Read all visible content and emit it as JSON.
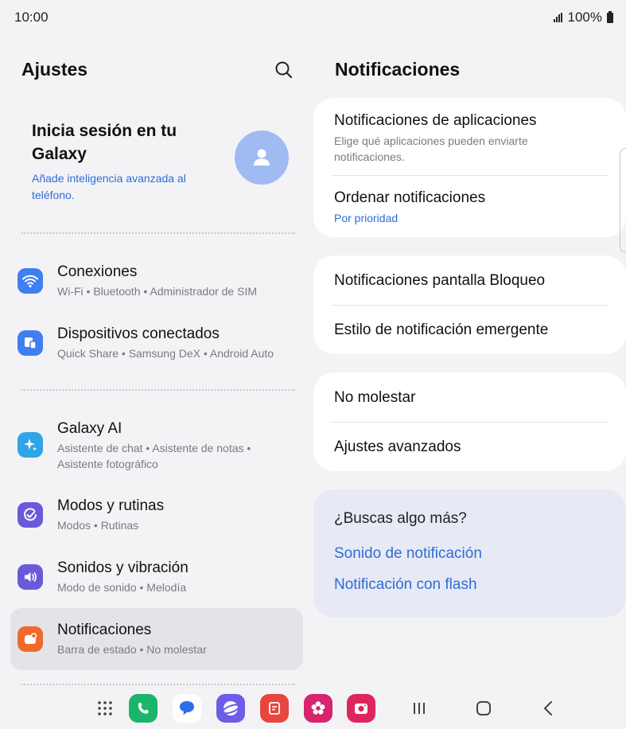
{
  "status_bar": {
    "time": "10:00",
    "battery_percent": "100%"
  },
  "settings": {
    "title": "Ajustes",
    "search_icon": "search-icon",
    "account": {
      "title": "Inicia sesión en tu Galaxy",
      "subtitle": "Añade inteligencia avanzada al teléfono.",
      "avatar_icon": "person-icon"
    },
    "items": [
      {
        "label": "Conexiones",
        "subtitle": "Wi-Fi  •  Bluetooth  •  Administrador de SIM",
        "icon": "wifi-icon",
        "color": "#3f7ff0"
      },
      {
        "label": "Dispositivos conectados",
        "subtitle": "Quick Share  •  Samsung DeX  •  Android Auto",
        "icon": "devices-icon",
        "color": "#3f7ff0"
      },
      {
        "label": "Galaxy AI",
        "subtitle": "Asistente de chat  •  Asistente de notas  •  Asistente fotográfico",
        "icon": "sparkle-icon",
        "color": "#2fa4e8"
      },
      {
        "label": "Modos y rutinas",
        "subtitle": "Modos  •  Rutinas",
        "icon": "check-circle-icon",
        "color": "#6a5ad8"
      },
      {
        "label": "Sonidos y vibración",
        "subtitle": "Modo de sonido  •  Melodía",
        "icon": "speaker-icon",
        "color": "#6a5ad8"
      },
      {
        "label": "Notificaciones",
        "subtitle": "Barra de estado  •  No molestar",
        "icon": "notification-icon",
        "color": "#ee6a2c",
        "selected": true
      }
    ]
  },
  "notifications": {
    "title": "Notificaciones",
    "groups": [
      {
        "rows": [
          {
            "label": "Notificaciones de aplicaciones",
            "subtitle": "Elige qué aplicaciones pueden enviarte notificaciones."
          },
          {
            "label": "Ordenar notificaciones",
            "subtitle": "Por prioridad"
          }
        ]
      },
      {
        "rows": [
          {
            "label": "Notificaciones pantalla Bloqueo"
          },
          {
            "label": "Estilo de notificación emergente"
          }
        ]
      },
      {
        "rows": [
          {
            "label": "No molestar"
          },
          {
            "label": "Ajustes avanzados"
          }
        ]
      }
    ],
    "looking_for_more": {
      "title": "¿Buscas algo más?",
      "links": [
        "Sonido de notificación",
        "Notificación con flash"
      ]
    }
  },
  "nav_bar": {
    "apps": [
      {
        "icon": "app-grid-icon",
        "color": "#ffffff"
      },
      {
        "icon": "phone-icon",
        "color": "#1bb56a"
      },
      {
        "icon": "messages-icon",
        "color": "#2b6ee8"
      },
      {
        "icon": "internet-icon",
        "color": "#6c5ce7"
      },
      {
        "icon": "notes-icon",
        "color": "#e8453c"
      },
      {
        "icon": "gallery-icon",
        "color": "#d6246e"
      },
      {
        "icon": "camera-icon",
        "color": "#e0245e"
      }
    ],
    "controls": [
      "recents-icon",
      "home-icon",
      "back-icon"
    ]
  }
}
